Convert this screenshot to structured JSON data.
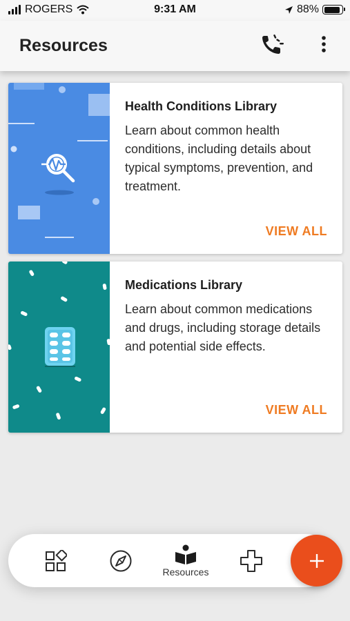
{
  "status_bar": {
    "carrier": "ROGERS",
    "time": "9:31 AM",
    "battery": "88%",
    "battery_level": 0.88
  },
  "header": {
    "title": "Resources",
    "phone_icon": "phone-call-icon",
    "more_icon": "more-vertical-icon"
  },
  "cards": [
    {
      "title": "Health Conditions Library",
      "description": "Learn about common health conditions, including details about typical symptoms, prevention, and treatment.",
      "action": "VIEW ALL",
      "icon": "magnifier-pulse-icon",
      "image_color": "#4a8be3"
    },
    {
      "title": "Medications Library",
      "description": "Learn about common medications and drugs, including storage details and potential side effects.",
      "action": "VIEW ALL",
      "icon": "pill-pack-icon",
      "image_color": "#0f8a8a"
    }
  ],
  "bottom_nav": {
    "items": [
      {
        "icon": "dashboard-icon",
        "label": ""
      },
      {
        "icon": "compass-icon",
        "label": ""
      },
      {
        "icon": "book-reader-icon",
        "label": "Resources"
      },
      {
        "icon": "medical-cross-icon",
        "label": ""
      }
    ],
    "fab_label": "+"
  },
  "colors": {
    "accent": "#ef7b22",
    "fab": "#ea4e1c",
    "background": "#ebebeb"
  }
}
